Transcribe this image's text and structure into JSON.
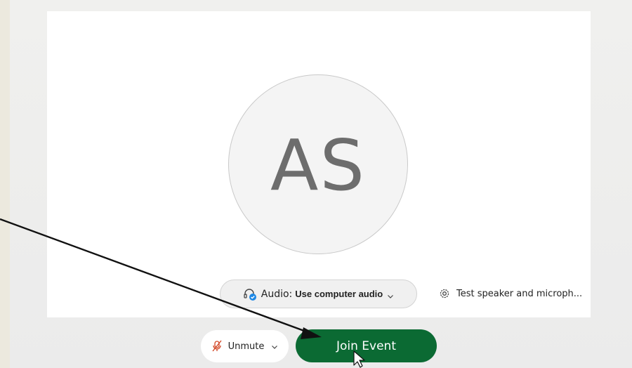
{
  "avatar": {
    "initials": "AS"
  },
  "audio": {
    "prefix": "Audio:",
    "value": "Use computer audio"
  },
  "test": {
    "label": "Test speaker and microph..."
  },
  "unmute": {
    "label": "Unmute"
  },
  "join": {
    "label": "Join Event"
  },
  "colors": {
    "join_bg": "#0b6a33",
    "mute_icon": "#d24726",
    "audio_check": "#1e88e5"
  },
  "icons": [
    "headset-check-icon",
    "chevron-down-icon",
    "gear-icon",
    "mic-muted-icon",
    "annotation-arrow-icon",
    "mouse-cursor-icon"
  ]
}
